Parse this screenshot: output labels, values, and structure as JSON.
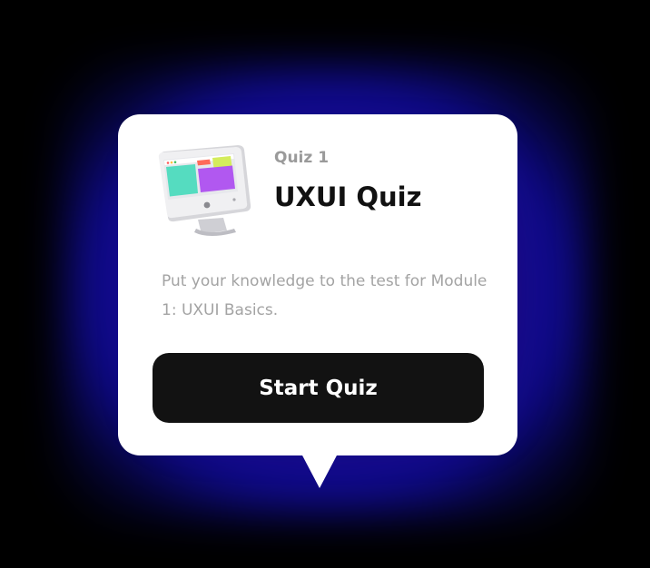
{
  "quiz_card": {
    "label": "Quiz 1",
    "title": "UXUI Quiz",
    "description": "Put your knowledge to the test for Module 1: UXUI Basics.",
    "start_button_label": "Start Quiz",
    "illustration_icon": "computer-monitor-icon"
  },
  "colors": {
    "card_background": "#ffffff",
    "button_background": "#121212",
    "glow_accent": "#1e10c8"
  }
}
